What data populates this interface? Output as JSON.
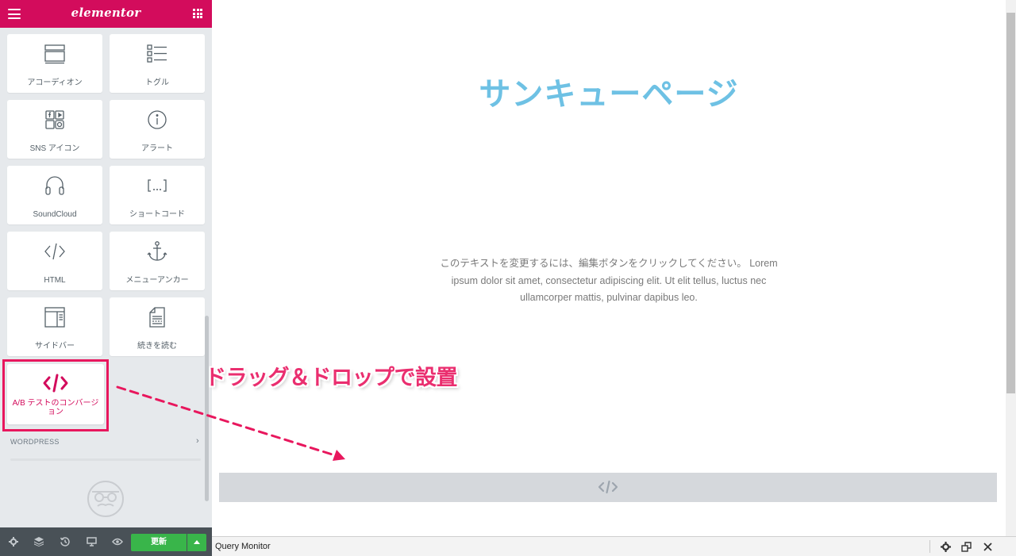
{
  "editor": {
    "logo": "elementor",
    "widgets": [
      {
        "label": "アコーディオン",
        "icon": "accordion-icon"
      },
      {
        "label": "トグル",
        "icon": "toggle-icon"
      },
      {
        "label": "SNS アイコン",
        "icon": "social-icons-icon"
      },
      {
        "label": "アラート",
        "icon": "alert-icon"
      },
      {
        "label": "SoundCloud",
        "icon": "soundcloud-icon"
      },
      {
        "label": "ショートコード",
        "icon": "shortcode-icon"
      },
      {
        "label": "HTML",
        "icon": "html-icon"
      },
      {
        "label": "メニューアンカー",
        "icon": "anchor-icon"
      },
      {
        "label": "サイドバー",
        "icon": "sidebar-icon"
      },
      {
        "label": "続きを読む",
        "icon": "read-more-icon"
      }
    ],
    "highlighted_widget": {
      "label": "A/B テストのコンバージョン",
      "icon": "code-icon"
    },
    "section_wordpress": "WORDPRESS",
    "footer": {
      "update_label": "更新",
      "icons": [
        "settings-icon",
        "navigator-icon",
        "history-icon",
        "responsive-icon",
        "preview-icon"
      ]
    }
  },
  "canvas": {
    "title": "サンキューページ",
    "text": "このテキストを変更するには、編集ボタンをクリックしてください。 Lorem ipsum dolor sit amet, consectetur adipiscing elit. Ut elit tellus, luctus nec ullamcorper mattis, pulvinar dapibus leo."
  },
  "annotation": "ドラッグ＆ドロップで設置",
  "query_monitor": {
    "title": "Query Monitor"
  },
  "colors": {
    "brand": "#d30c5c",
    "accent_text": "#6ec1e4",
    "update_green": "#39b54a",
    "annotation": "#ea2e6f"
  }
}
